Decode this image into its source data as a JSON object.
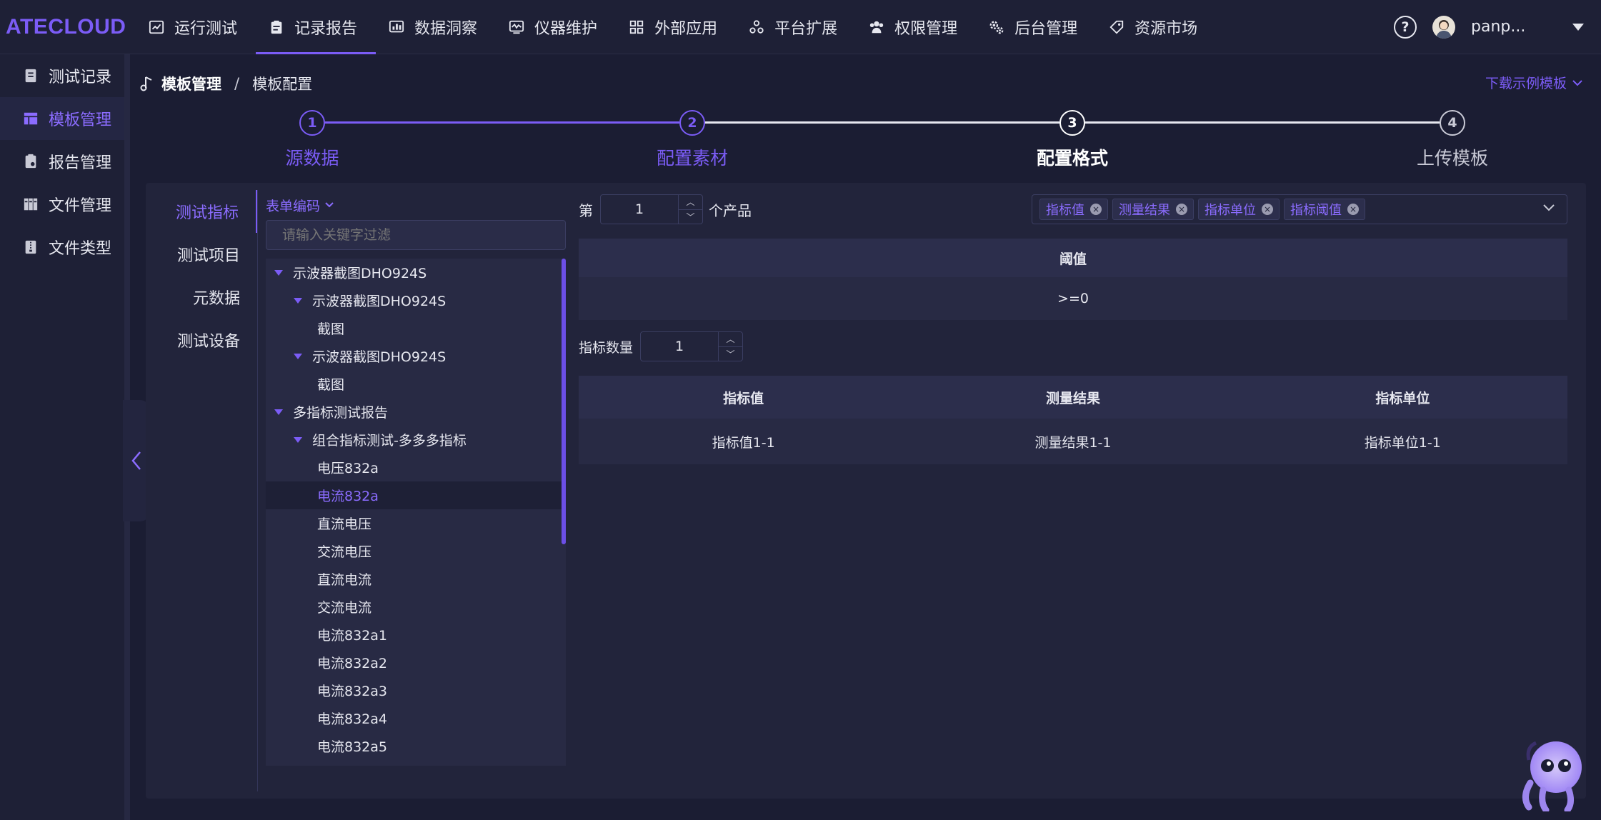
{
  "app": {
    "logo": "ATECLOUD"
  },
  "topnav": [
    {
      "label": "运行测试",
      "icon": "chart-line-icon"
    },
    {
      "label": "记录报告",
      "icon": "clipboard-icon",
      "active": true
    },
    {
      "label": "数据洞察",
      "icon": "bar-chart-icon"
    },
    {
      "label": "仪器维护",
      "icon": "monitor-icon"
    },
    {
      "label": "外部应用",
      "icon": "grid-icon"
    },
    {
      "label": "平台扩展",
      "icon": "nodes-icon"
    },
    {
      "label": "权限管理",
      "icon": "users-icon"
    },
    {
      "label": "后台管理",
      "icon": "gears-icon"
    },
    {
      "label": "资源市场",
      "icon": "tag-icon"
    }
  ],
  "user": {
    "name": "panp..."
  },
  "help": {
    "symbol": "?"
  },
  "sidebar": {
    "items": [
      {
        "label": "测试记录"
      },
      {
        "label": "模板管理",
        "active": true
      },
      {
        "label": "报告管理"
      },
      {
        "label": "文件管理"
      },
      {
        "label": "文件类型"
      }
    ]
  },
  "breadcrumb": {
    "root": "模板管理",
    "current": "模板配置",
    "separator": "/"
  },
  "download": {
    "label": "下载示例模板"
  },
  "steps": [
    {
      "num": "1",
      "label": "源数据",
      "state": "done"
    },
    {
      "num": "2",
      "label": "配置素材",
      "state": "done"
    },
    {
      "num": "3",
      "label": "配置格式",
      "state": "current"
    },
    {
      "num": "4",
      "label": "上传模板",
      "state": "pending"
    }
  ],
  "left_tabs": [
    {
      "label": "测试指标",
      "active": true
    },
    {
      "label": "测试项目"
    },
    {
      "label": "元数据"
    },
    {
      "label": "测试设备"
    }
  ],
  "tree_panel": {
    "header": "表单编码",
    "filter_placeholder": "请输入关键字过滤",
    "nodes": [
      {
        "label": "示波器截图DHO924S",
        "level": 0,
        "caret": true
      },
      {
        "label": "示波器截图DHO924S",
        "level": 1,
        "caret": true
      },
      {
        "label": "截图",
        "level": 2
      },
      {
        "label": "示波器截图DHO924S",
        "level": 1,
        "caret": true
      },
      {
        "label": "截图",
        "level": 2
      },
      {
        "label": "多指标测试报告",
        "level": 0,
        "caret": true
      },
      {
        "label": "组合指标测试-多多多指标",
        "level": 1,
        "caret": true
      },
      {
        "label": "电压832a",
        "level": 2
      },
      {
        "label": "电流832a",
        "level": 2,
        "selected": true
      },
      {
        "label": "直流电压",
        "level": 2
      },
      {
        "label": "交流电压",
        "level": 2
      },
      {
        "label": "直流电流",
        "level": 2
      },
      {
        "label": "交流电流",
        "level": 2
      },
      {
        "label": "电流832a1",
        "level": 2
      },
      {
        "label": "电流832a2",
        "level": 2
      },
      {
        "label": "电流832a3",
        "level": 2
      },
      {
        "label": "电流832a4",
        "level": 2
      },
      {
        "label": "电流832a5",
        "level": 2
      }
    ]
  },
  "config": {
    "product_prefix": "第",
    "product_value": "1",
    "product_suffix": "个产品",
    "tags": [
      "指标值",
      "测量结果",
      "指标单位",
      "指标阈值"
    ],
    "threshold_table": {
      "header": "阈值",
      "value": ">=0"
    },
    "count_label": "指标数量",
    "count_value": "1",
    "indicator_table": {
      "headers": [
        "指标值",
        "测量结果",
        "指标单位"
      ],
      "row": [
        "指标值1-1",
        "测量结果1-1",
        "指标单位1-1"
      ]
    }
  },
  "colors": {
    "accent": "#7b5cf6",
    "bg": "#1b1d33",
    "panel": "#22243b"
  }
}
